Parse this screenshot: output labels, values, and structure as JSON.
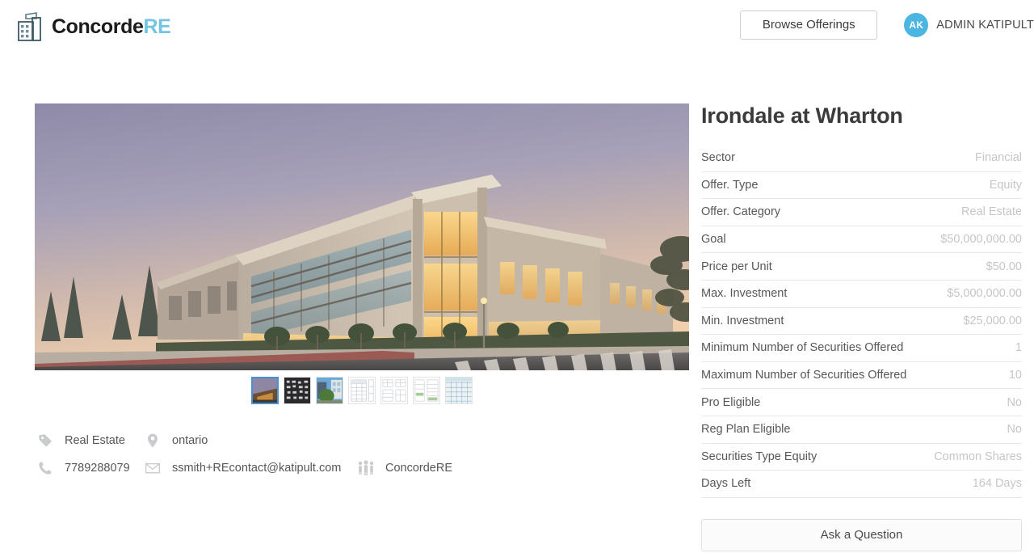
{
  "header": {
    "brand_name_main": "Concorde",
    "brand_name_accent": "RE",
    "brand_logo_icon": "office-building-icon",
    "browse_label": "Browse Offerings",
    "avatar_initials": "AK",
    "user_name": "ADMIN KATIPULT",
    "avatar_color": "#4cb6e3",
    "accent_color": "#73c4e2"
  },
  "gallery": {
    "hero_alt": "modern office building at dusk with lit interior",
    "thumbnails": [
      {
        "name": "building-exterior-dusk",
        "type": "photo",
        "selected": true
      },
      {
        "name": "building-facade-night",
        "type": "photo",
        "selected": false
      },
      {
        "name": "building-with-trees",
        "type": "photo",
        "selected": false
      },
      {
        "name": "financial-spreadsheet-1",
        "type": "document",
        "selected": false
      },
      {
        "name": "financial-spreadsheet-2",
        "type": "document",
        "selected": false
      },
      {
        "name": "financial-spreadsheet-3",
        "type": "document",
        "selected": false
      },
      {
        "name": "financial-spreadsheet-4",
        "type": "document",
        "selected": false
      }
    ]
  },
  "meta": {
    "row1": [
      {
        "icon": "tag-icon",
        "label": "Real Estate"
      },
      {
        "icon": "location-pin-icon",
        "label": "ontario"
      }
    ],
    "row2": [
      {
        "icon": "phone-icon",
        "label": "7789288079"
      },
      {
        "icon": "envelope-icon",
        "label": "ssmith+REcontact@katipult.com"
      },
      {
        "icon": "people-group-icon",
        "label": "ConcordeRE"
      }
    ]
  },
  "offering": {
    "title": "Irondale at Wharton",
    "details": [
      {
        "label": "Sector",
        "value": "Financial"
      },
      {
        "label": "Offer. Type",
        "value": "Equity"
      },
      {
        "label": "Offer. Category",
        "value": "Real Estate"
      },
      {
        "label": "Goal",
        "value": "$50,000,000.00"
      },
      {
        "label": "Price per Unit",
        "value": "$50.00"
      },
      {
        "label": "Max. Investment",
        "value": "$5,000,000.00"
      },
      {
        "label": "Min. Investment",
        "value": "$25,000.00"
      },
      {
        "label": "Minimum Number of Securities Offered",
        "value": "1"
      },
      {
        "label": "Maximum Number of Securities Offered",
        "value": "10"
      },
      {
        "label": "Pro Eligible",
        "value": "No"
      },
      {
        "label": "Reg Plan Eligible",
        "value": "No"
      },
      {
        "label": "Securities Type Equity",
        "value": "Common Shares"
      },
      {
        "label": "Days Left",
        "value": "164 Days"
      }
    ],
    "ask_question_label": "Ask a Question"
  }
}
